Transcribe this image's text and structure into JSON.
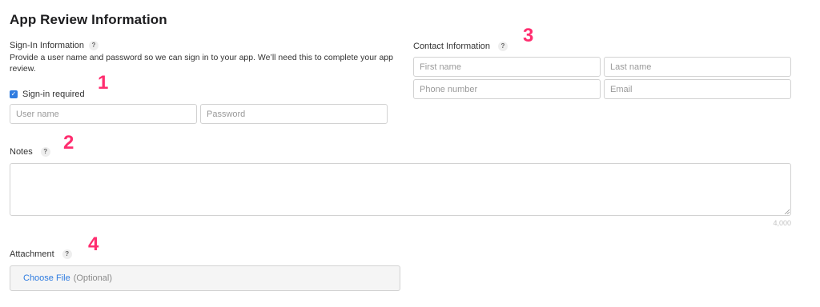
{
  "header": {
    "title": "App Review Information"
  },
  "sign_in": {
    "label": "Sign-In Information",
    "help": "?",
    "description": "Provide a user name and password so we can sign in to your app. We’ll need this to complete your app review.",
    "checkbox_label": "Sign-in required",
    "checkbox_checked": true,
    "checkbox_mark": "✓",
    "username_placeholder": "User name",
    "password_placeholder": "Password"
  },
  "contact": {
    "label": "Contact Information",
    "help": "?",
    "first_name_placeholder": "First name",
    "last_name_placeholder": "Last name",
    "phone_placeholder": "Phone number",
    "email_placeholder": "Email"
  },
  "notes": {
    "label": "Notes",
    "help": "?",
    "char_limit": "4,000"
  },
  "attachment": {
    "label": "Attachment",
    "help": "?",
    "choose_file": "Choose File",
    "optional": "(Optional)"
  },
  "annotations": {
    "marker_1": "1",
    "marker_2": "2",
    "marker_3": "3",
    "marker_4": "4"
  },
  "colors": {
    "accent": "#2f7ce0",
    "marker": "#ff2d6f",
    "border": "#d2d2d2"
  }
}
